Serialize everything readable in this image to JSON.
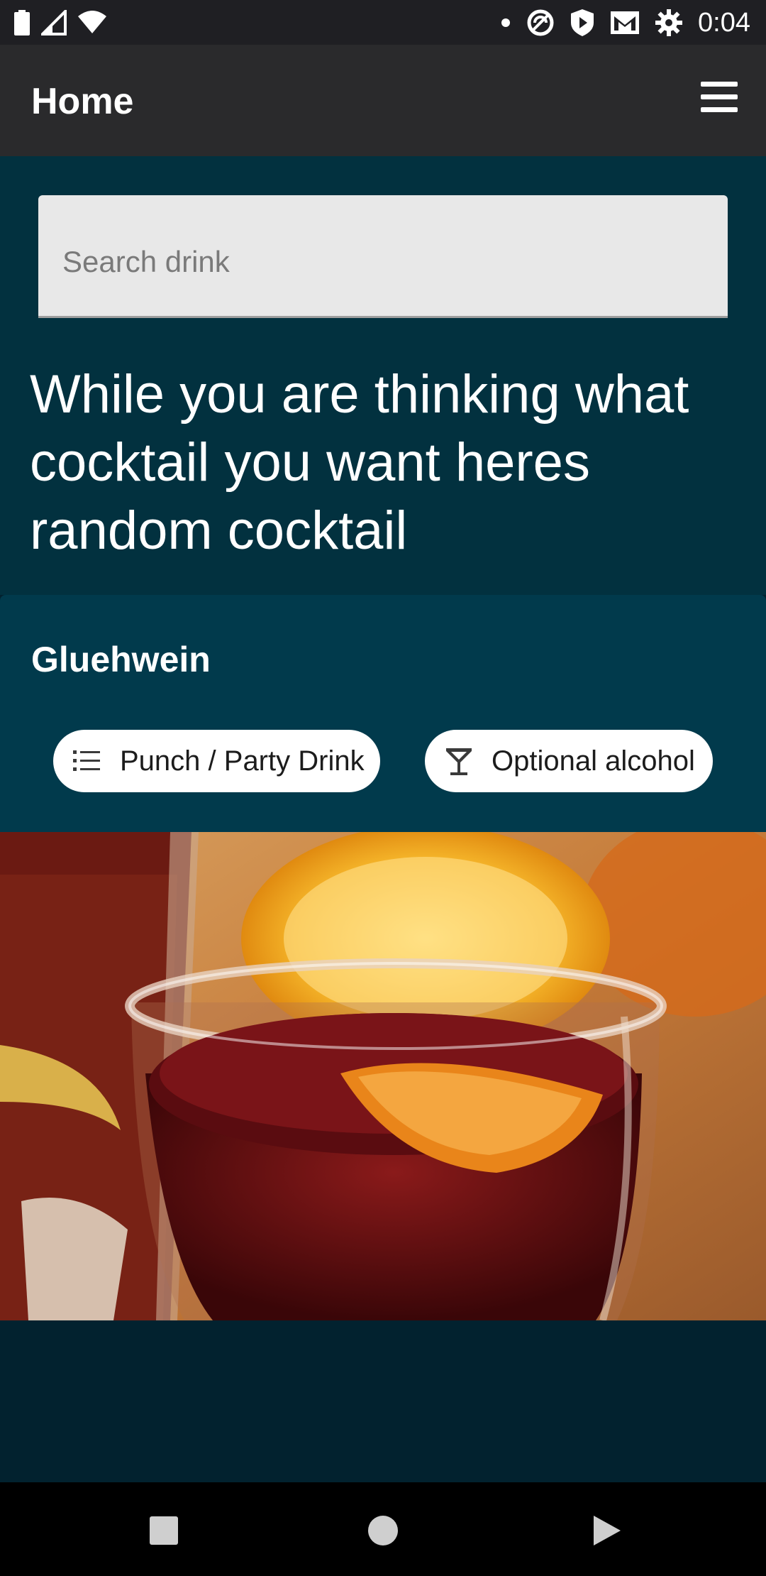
{
  "status_bar": {
    "time": "0:04",
    "icons": [
      "battery-icon",
      "signal-icon",
      "wifi-icon",
      "dot-icon",
      "sync-icon",
      "shield-play-icon",
      "gmail-icon",
      "settings-icon"
    ]
  },
  "app_bar": {
    "title": "Home",
    "menu_icon": "hamburger-menu-icon"
  },
  "search": {
    "placeholder": "Search drink",
    "value": ""
  },
  "intro_text": "While you are thinking what cocktail you want heres random cocktail",
  "random_cocktail": {
    "name": "Gluehwein",
    "category": "Punch / Party Drink",
    "category_icon": "list-icon",
    "alcoholic": "Optional alcohol",
    "alcoholic_icon": "cocktail-glass-icon",
    "image_alt": "Gluehwein"
  },
  "nav_bar": {
    "buttons": [
      "recent-apps-icon",
      "home-icon",
      "back-icon"
    ]
  },
  "colors": {
    "status_bar_bg": "#1f1f23",
    "app_bar_bg": "#2a2a2c",
    "main_bg": "#02313f",
    "card_bg": "#013a4c",
    "page_bg": "#02222f",
    "search_bg": "#e8e8e8",
    "chip_bg": "#ffffff"
  }
}
